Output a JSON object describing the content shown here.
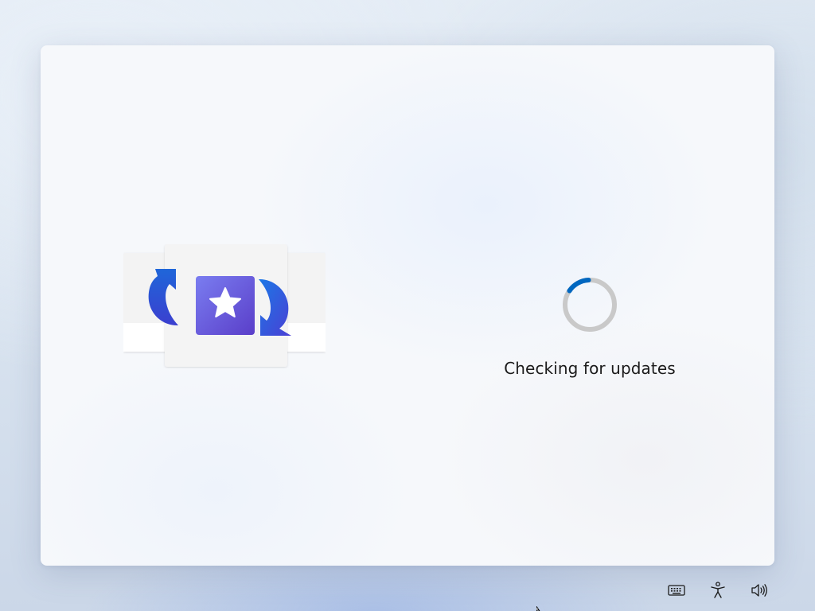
{
  "status": {
    "message": "Checking for updates"
  },
  "hero": {
    "illustration_icon": "windows-update-store-icon"
  },
  "spinner": {
    "icon": "loading-spinner-icon",
    "track_color": "#c8c8c8",
    "accent_color": "#0067c0"
  },
  "tray": {
    "items": [
      {
        "icon": "keyboard-icon"
      },
      {
        "icon": "accessibility-icon"
      },
      {
        "icon": "volume-icon"
      }
    ]
  }
}
